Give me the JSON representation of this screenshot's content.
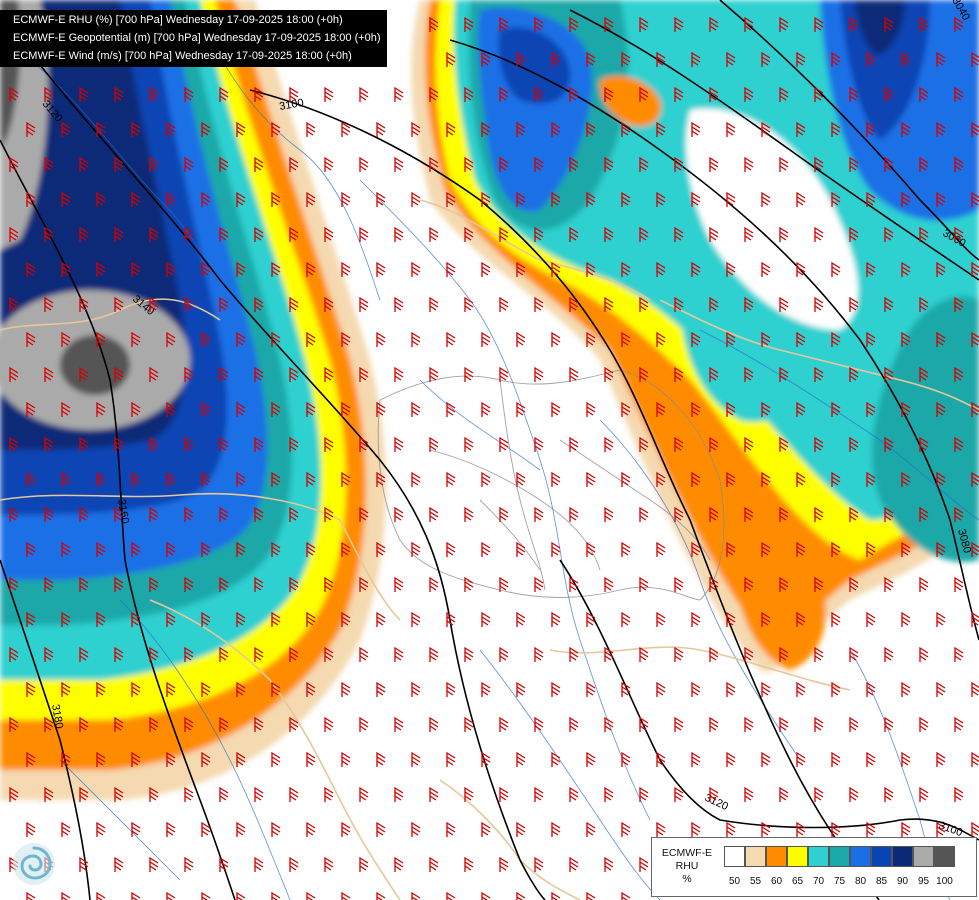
{
  "header": {
    "lines": [
      "ECMWF-E RHU (%) [700 hPa] Wednesday 17-09-2025 18:00 (+0h)",
      "ECMWF-E Geopotential (m) [700 hPa] Wednesday 17-09-2025 18:00 (+0h)",
      "ECMWF-E Wind (m/s) [700 hPa] Wednesday 17-09-2025 18:00 (+0h)"
    ]
  },
  "contours": {
    "labels": [
      "3120",
      "3100",
      "3140",
      "3160",
      "3180",
      "3040",
      "3060",
      "3080",
      "3120",
      "3100"
    ],
    "line_color": "#000000"
  },
  "legend": {
    "title_lines": [
      "ECMWF-E",
      "RHU",
      "%"
    ],
    "levels": [
      "50",
      "55",
      "60",
      "65",
      "70",
      "75",
      "80",
      "85",
      "90",
      "95",
      "100"
    ],
    "colors": [
      "#ffffff",
      "#f5d9b0",
      "#ff8c00",
      "#ffff00",
      "#2ed0d0",
      "#1aa8a8",
      "#1a6fe6",
      "#0a45b4",
      "#0a2a78",
      "#aaaaaa",
      "#555555"
    ]
  },
  "map_colors": {
    "barb": "#d40000",
    "coast": "#e6c79a",
    "river": "#2a6acc",
    "border": "#8a8a8a"
  },
  "logo": {
    "icon": "swirl-logo-icon"
  }
}
